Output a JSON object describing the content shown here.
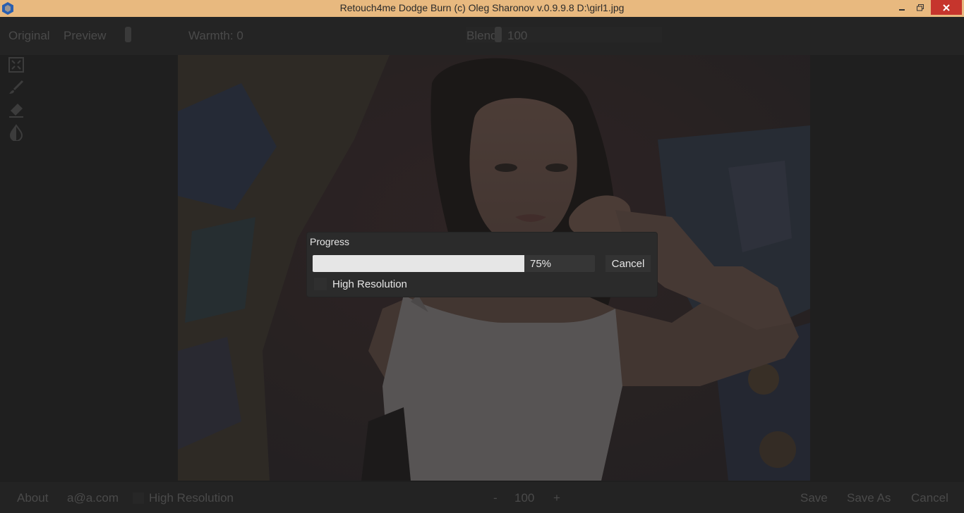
{
  "window": {
    "title": "Retouch4me Dodge Burn (c) Oleg Sharonov v.0.9.9.8  D:\\girl1.jpg",
    "app_icon": "retouch4me-logo-icon",
    "controls": {
      "minimize": "minimize-icon",
      "maximize": "restore-icon",
      "close": "close-icon"
    }
  },
  "toolbar": {
    "original_label": "Original",
    "preview_label": "Preview",
    "warmth_label": "Warmth: 0",
    "blend_label": "Blend",
    "blend_value": "100"
  },
  "tools": [
    {
      "icon": "fit-screen-icon"
    },
    {
      "icon": "brush-icon"
    },
    {
      "icon": "eraser-icon"
    },
    {
      "icon": "contrast-drop-icon"
    }
  ],
  "bottombar": {
    "about_label": "About",
    "email": "a@a.com",
    "high_resolution_label": "High Resolution",
    "zoom_minus": "-",
    "zoom_value": "100",
    "zoom_plus": "+",
    "save_label": "Save",
    "save_as_label": "Save As",
    "cancel_label": "Cancel"
  },
  "progress_dialog": {
    "title": "Progress",
    "progress_percent": 75,
    "progress_text": "75%",
    "cancel_label": "Cancel",
    "high_resolution_label": "High Resolution",
    "high_resolution_checked": false
  },
  "colors": {
    "titlebar": "#e8b97f",
    "close_button": "#c6352d",
    "background": "#1f1f1f",
    "dialog": "#2b2b2b",
    "progress_fill": "#e6e6e6"
  }
}
